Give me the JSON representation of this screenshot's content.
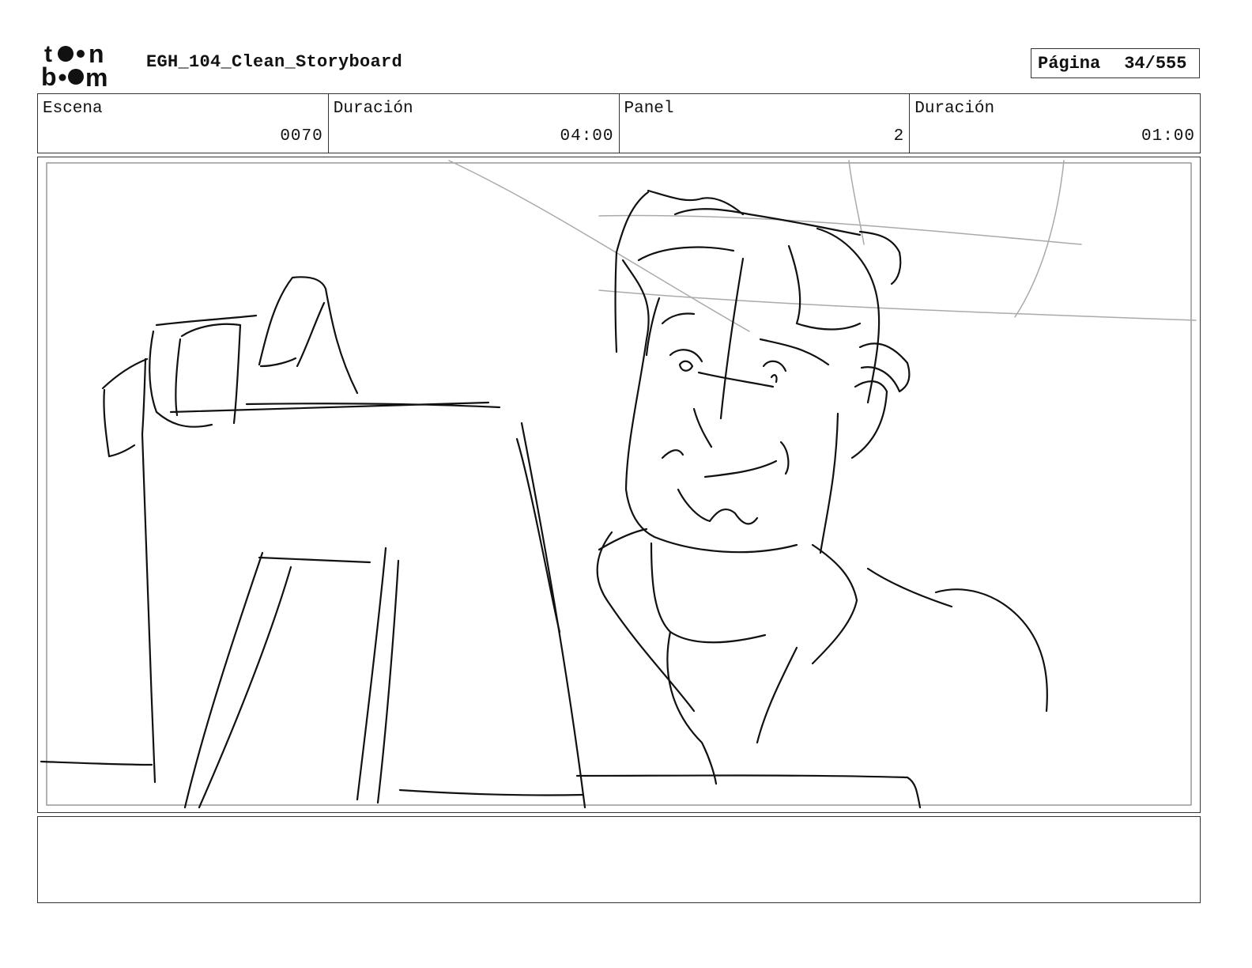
{
  "header": {
    "brand": "toon boom",
    "title": "EGH_104_Clean_Storyboard",
    "page_label": "Página",
    "page_value": "34/555"
  },
  "info": {
    "scene_label": "Escena",
    "scene_value": "0070",
    "scene_duration_label": "Duración",
    "scene_duration_value": "04:00",
    "panel_label": "Panel",
    "panel_value": "2",
    "panel_duration_label": "Duración",
    "panel_duration_value": "01:00"
  },
  "notes": {
    "text": ""
  }
}
